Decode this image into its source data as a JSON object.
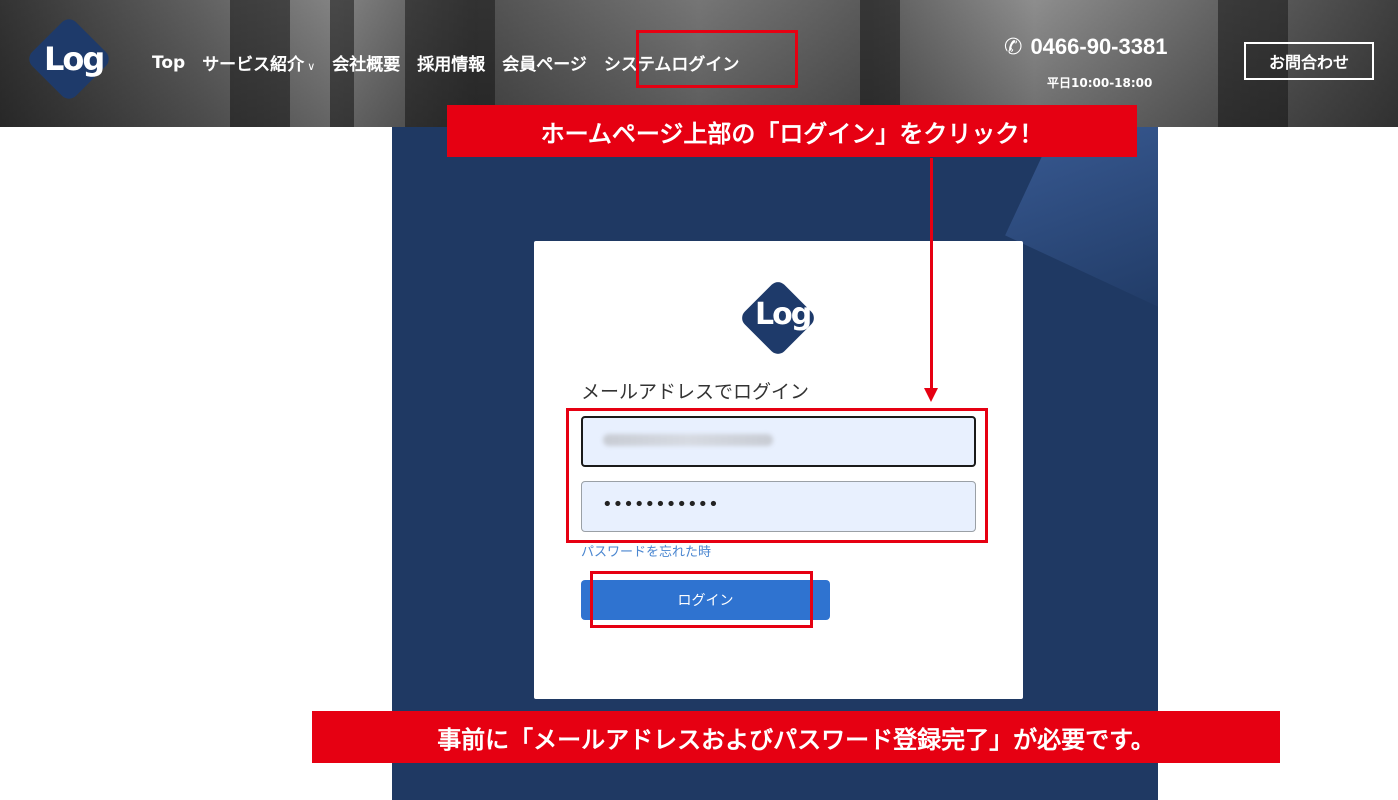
{
  "header": {
    "logo_text": "Log",
    "nav": [
      {
        "label": "Top"
      },
      {
        "label": "サービス紹介",
        "chevron": "chevron-down-icon"
      },
      {
        "label": "会社概要"
      },
      {
        "label": "採用情報"
      },
      {
        "label": "会員ページ"
      },
      {
        "label": "システムログイン"
      }
    ],
    "phone_icon": "phone-icon",
    "phone": "0466-90-3381",
    "hours": "平日10:00-18:00",
    "contact_label": "お問合わせ"
  },
  "annotations": {
    "top_label": "ホームページ上部の「ログイン」をクリック！",
    "bottom_label": "事前に「メールアドレスおよびパスワード登録完了」が必要です。",
    "accent_color": "#e60012"
  },
  "login": {
    "logo_text": "Log",
    "heading": "メールアドレスでログイン",
    "password_mask": "•••••••••••",
    "forgot_link": "パスワードを忘れた時",
    "button_label": "ログイン"
  },
  "colors": {
    "panel": "#1f3963",
    "button": "#2f73d0",
    "input_bg": "#e8f0fe",
    "link": "#4a86d0"
  }
}
